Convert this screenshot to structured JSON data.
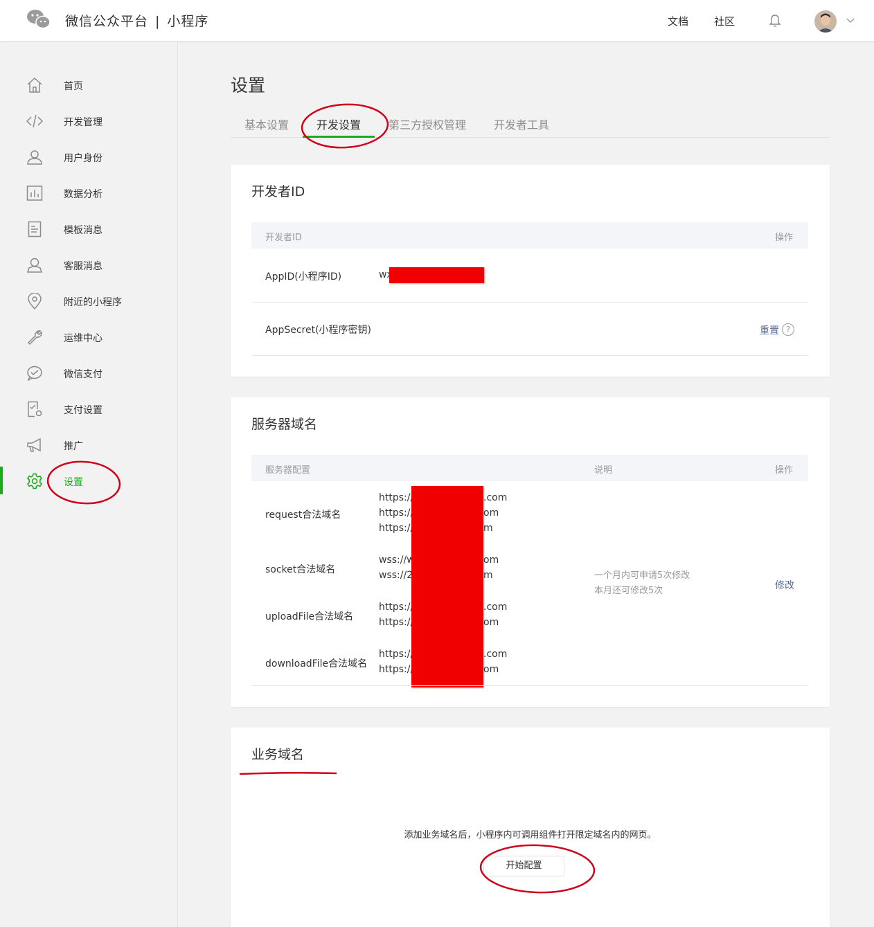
{
  "header": {
    "brand": "微信公众平台",
    "separator": "|",
    "product": "小程序",
    "links": [
      "文档",
      "社区"
    ]
  },
  "sidebar": {
    "items": [
      {
        "label": "首页",
        "icon": "home-icon"
      },
      {
        "label": "开发管理",
        "icon": "code-icon"
      },
      {
        "label": "用户身份",
        "icon": "user-icon"
      },
      {
        "label": "数据分析",
        "icon": "chart-icon"
      },
      {
        "label": "模板消息",
        "icon": "document-icon"
      },
      {
        "label": "客服消息",
        "icon": "customer-service-icon"
      },
      {
        "label": "附近的小程序",
        "icon": "location-pin-icon"
      },
      {
        "label": "运维中心",
        "icon": "wrench-icon"
      },
      {
        "label": "微信支付",
        "icon": "wechat-pay-icon"
      },
      {
        "label": "支付设置",
        "icon": "payment-settings-icon"
      },
      {
        "label": "推广",
        "icon": "megaphone-icon"
      },
      {
        "label": "设置",
        "icon": "gear-icon",
        "active": true
      }
    ]
  },
  "main": {
    "title": "设置",
    "tabs": [
      "基本设置",
      "开发设置",
      "第三方授权管理",
      "开发者工具"
    ],
    "active_tab": "开发设置",
    "developer_id": {
      "title": "开发者ID",
      "col_id": "开发者ID",
      "col_op": "操作",
      "appid_label": "AppID(小程序ID)",
      "appid_prefix": "wx",
      "secret_label": "AppSecret(小程序密钥)",
      "reset": "重置",
      "help": "?"
    },
    "server_domain": {
      "title": "服务器域名",
      "col_config": "服务器配置",
      "col_desc": "说明",
      "col_op": "操作",
      "request_label": "request合法域名",
      "request_urls": [
        "https://",
        "https://",
        "https://"
      ],
      "request_suffix": [
        ".com",
        "om",
        "m"
      ],
      "socket_label": "socket合法域名",
      "socket_urls": [
        "wss://w",
        "wss://2"
      ],
      "socket_suffix": [
        "om",
        "m"
      ],
      "upload_label": "uploadFile合法域名",
      "upload_urls": [
        "https://",
        "https://"
      ],
      "upload_suffix": [
        ".com",
        "om"
      ],
      "download_label": "downloadFile合法域名",
      "download_urls": [
        "https://",
        "https://"
      ],
      "download_suffix": [
        ".com",
        "om"
      ],
      "desc_line1": "一个月内可申请5次修改",
      "desc_line2": "本月还可修改5次",
      "modify": "修改"
    },
    "business_domain": {
      "title": "业务域名",
      "tip": "添加业务域名后，小程序内可调用组件打开限定域名内的网页。",
      "start_button": "开始配置"
    }
  },
  "colors": {
    "accent": "#1aad19",
    "link": "#576b95",
    "redaction": "#f00000",
    "annotation": "#d0021b"
  }
}
